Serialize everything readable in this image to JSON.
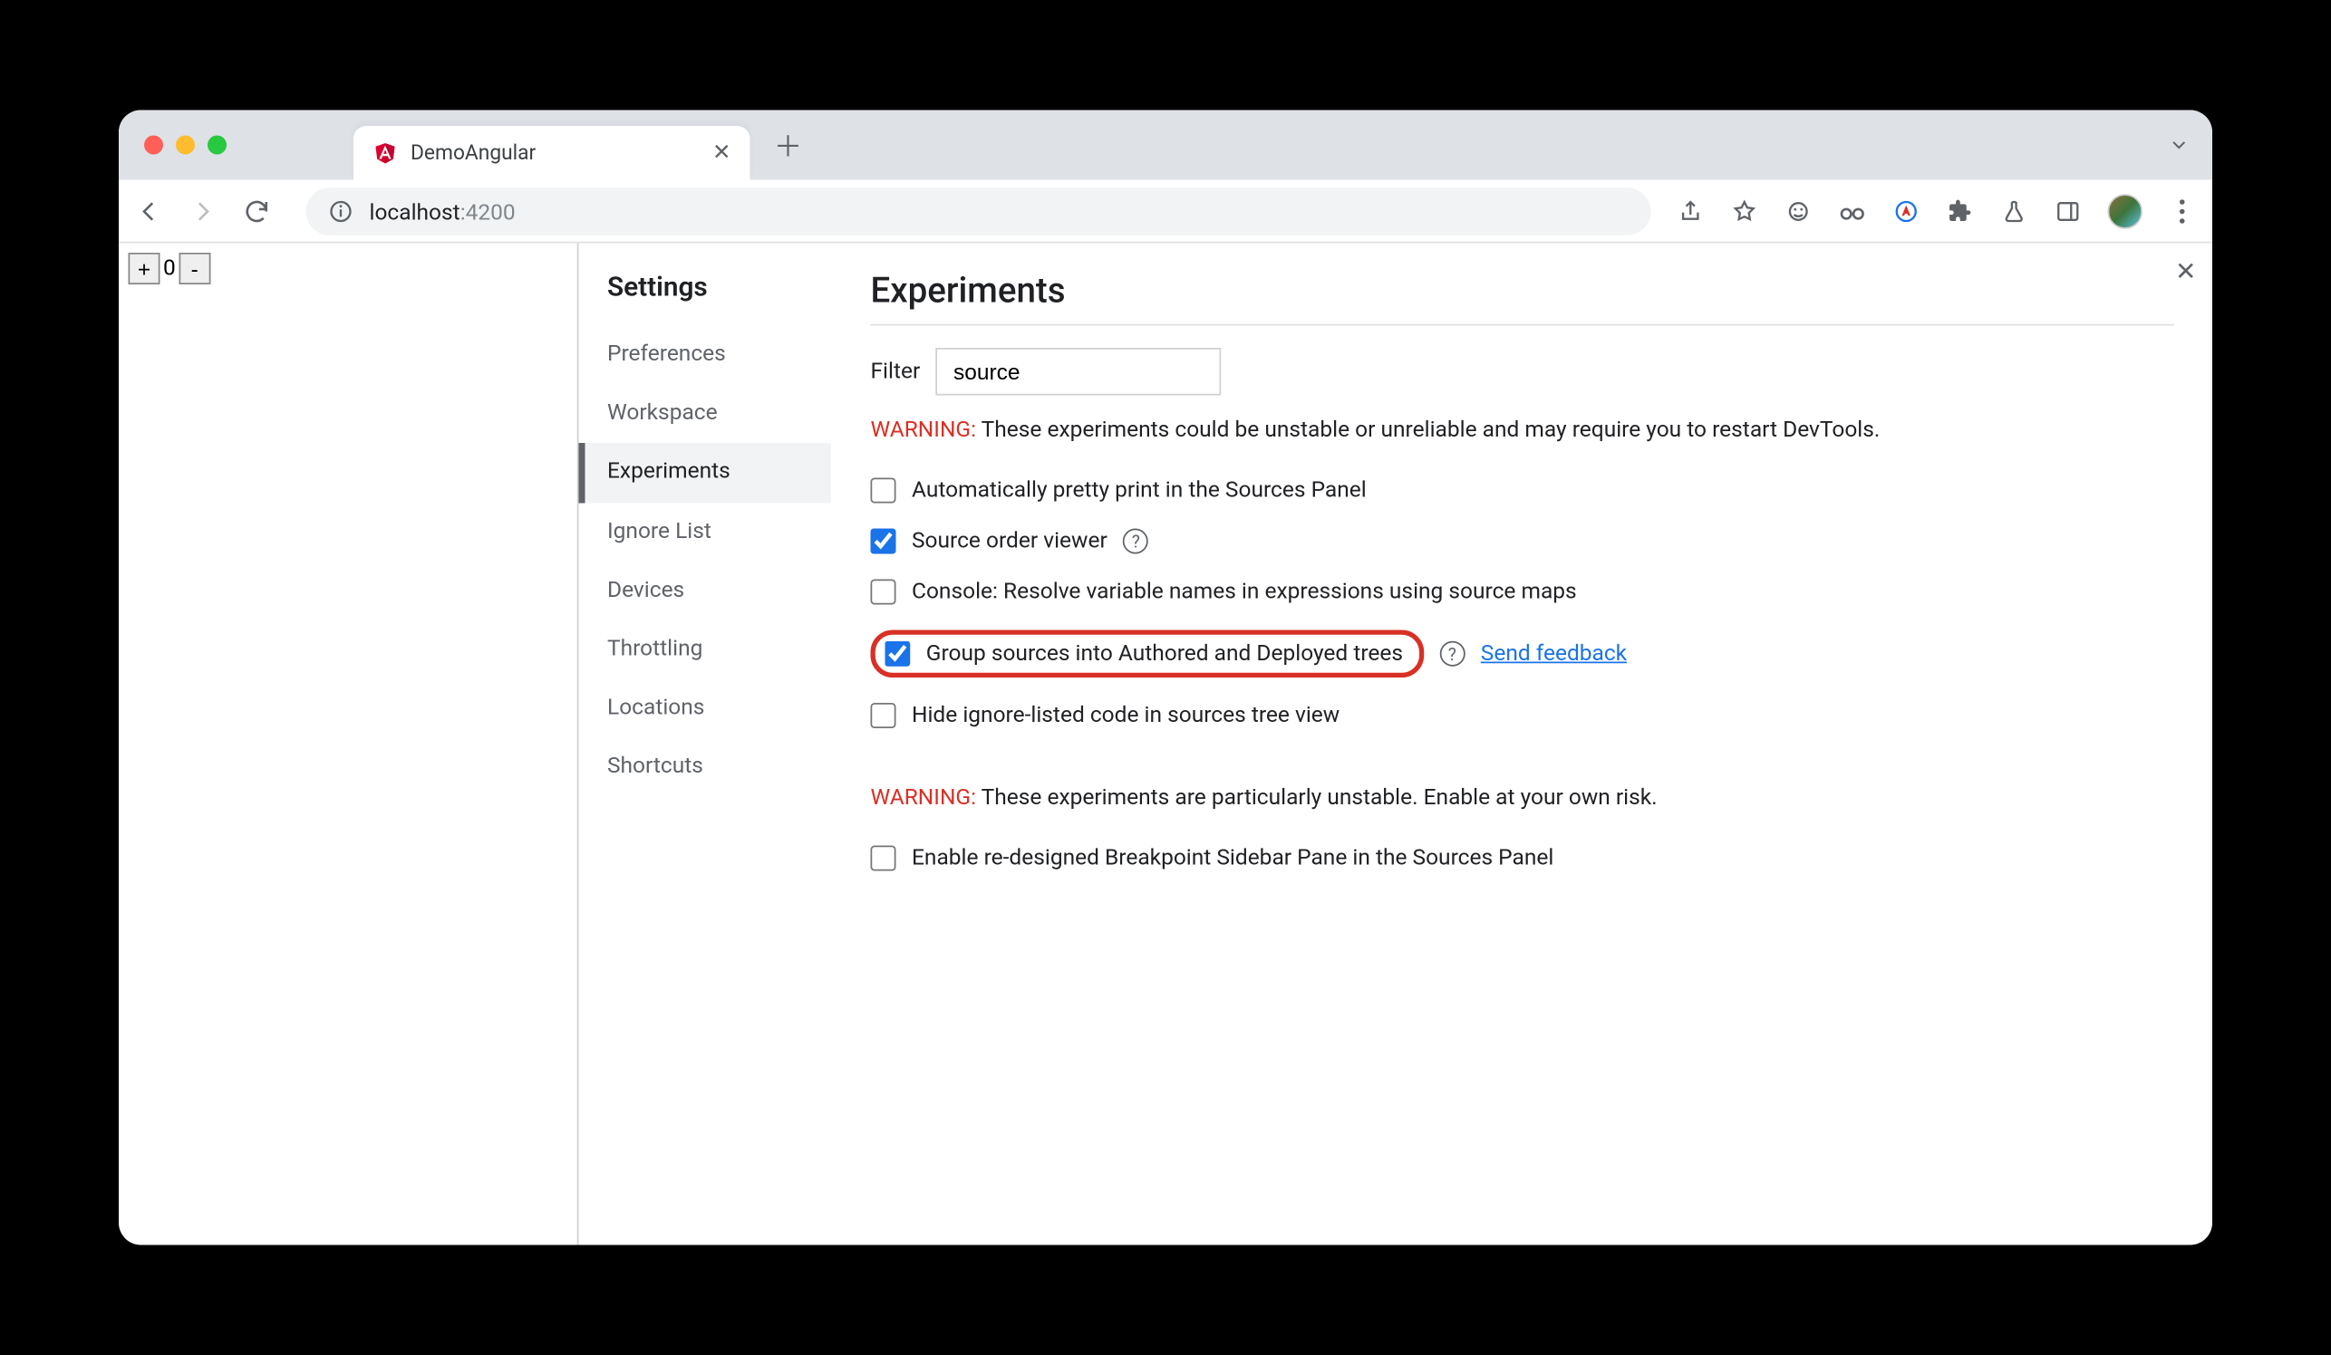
{
  "browser": {
    "tab_title": "DemoAngular",
    "url_host": "localhost",
    "url_port": ":4200"
  },
  "page": {
    "counter_plus": "+",
    "counter_value": "0",
    "counter_minus": "-"
  },
  "settings": {
    "title": "Settings",
    "sidebar": [
      {
        "label": "Preferences",
        "active": false
      },
      {
        "label": "Workspace",
        "active": false
      },
      {
        "label": "Experiments",
        "active": true
      },
      {
        "label": "Ignore List",
        "active": false
      },
      {
        "label": "Devices",
        "active": false
      },
      {
        "label": "Throttling",
        "active": false
      },
      {
        "label": "Locations",
        "active": false
      },
      {
        "label": "Shortcuts",
        "active": false
      }
    ],
    "main": {
      "heading": "Experiments",
      "filter_label": "Filter",
      "filter_value": "source",
      "warning1_label": "WARNING:",
      "warning1_text": " These experiments could be unstable or unreliable and may require you to restart DevTools.",
      "experiments": [
        {
          "label": "Automatically pretty print in the Sources Panel",
          "checked": false,
          "help": false
        },
        {
          "label": "Source order viewer",
          "checked": true,
          "help": true
        },
        {
          "label": "Console: Resolve variable names in expressions using source maps",
          "checked": false,
          "help": false
        },
        {
          "label": "Group sources into Authored and Deployed trees",
          "checked": true,
          "help": true,
          "highlighted": true,
          "feedback": "Send feedback"
        },
        {
          "label": "Hide ignore-listed code in sources tree view",
          "checked": false,
          "help": false
        }
      ],
      "warning2_label": "WARNING:",
      "warning2_text": " These experiments are particularly unstable. Enable at your own risk.",
      "unstable_experiments": [
        {
          "label": "Enable re-designed Breakpoint Sidebar Pane in the Sources Panel",
          "checked": false
        }
      ]
    }
  }
}
